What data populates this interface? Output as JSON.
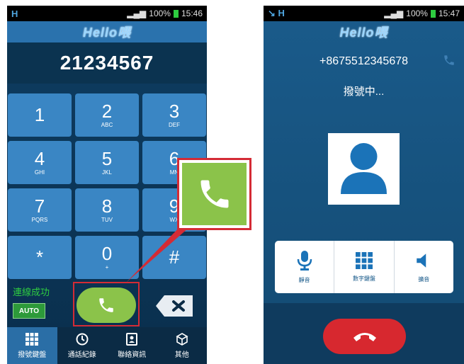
{
  "left_screen": {
    "status": {
      "time": "15:46",
      "battery": "100%"
    },
    "brand": "Hello喂",
    "dialed_number": "21234567",
    "keys": [
      {
        "digit": "1",
        "letters": ""
      },
      {
        "digit": "2",
        "letters": "ABC"
      },
      {
        "digit": "3",
        "letters": "DEF"
      },
      {
        "digit": "4",
        "letters": "GHI"
      },
      {
        "digit": "5",
        "letters": "JKL"
      },
      {
        "digit": "6",
        "letters": "MN"
      },
      {
        "digit": "7",
        "letters": "PQRS"
      },
      {
        "digit": "8",
        "letters": "TUV"
      },
      {
        "digit": "9",
        "letters": "WX"
      },
      {
        "digit": "*",
        "letters": ""
      },
      {
        "digit": "0",
        "letters": "+"
      },
      {
        "digit": "#",
        "letters": ""
      }
    ],
    "connection_status": "連線成功",
    "auto_label": "AUTO",
    "tabs": [
      {
        "label": "撥號鍵盤",
        "icon": "keypad-icon"
      },
      {
        "label": "通話紀錄",
        "icon": "clock-icon"
      },
      {
        "label": "聯絡資訊",
        "icon": "contacts-icon"
      },
      {
        "label": "其他",
        "icon": "more-icon"
      }
    ]
  },
  "right_screen": {
    "status": {
      "time": "15:47",
      "battery": "100%"
    },
    "brand": "Hello喂",
    "number": "+8675512345678",
    "state": "撥號中...",
    "controls": [
      {
        "label": "靜音",
        "icon": "microphone-icon"
      },
      {
        "label": "數字鍵盤",
        "icon": "keypad-icon"
      },
      {
        "label": "擴音",
        "icon": "speaker-icon"
      }
    ]
  },
  "colors": {
    "call_green": "#8bc34a",
    "end_red": "#d7282f",
    "highlight_red": "#d42b35",
    "key_blue": "#3a86c4"
  }
}
